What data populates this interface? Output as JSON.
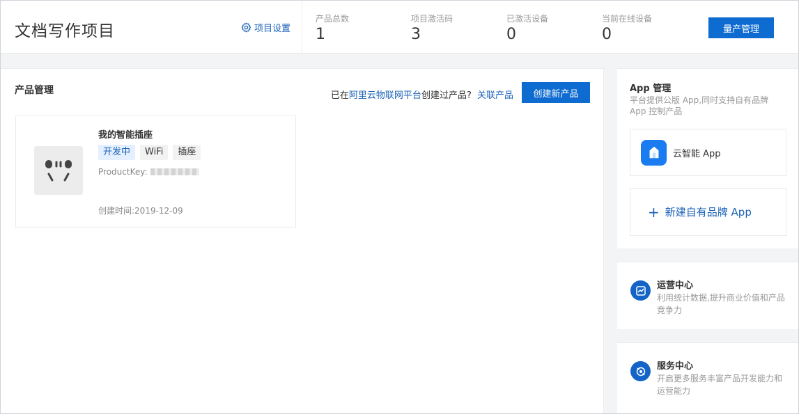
{
  "header": {
    "title": "文档写作项目",
    "settings_label": "项目设置",
    "stats": [
      {
        "label": "产品总数",
        "value": "1"
      },
      {
        "label": "项目激活码",
        "value": "3"
      },
      {
        "label": "已激活设备",
        "value": "0"
      },
      {
        "label": "当前在线设备",
        "value": "0"
      }
    ],
    "mass_production_label": "量产管理"
  },
  "product_management": {
    "title": "产品管理",
    "link_prefix": "已在",
    "platform_link": "阿里云物联网平台",
    "link_middle": "创建过产品?",
    "associate_link": "关联产品",
    "create_button": "创建新产品",
    "products": [
      {
        "name": "我的智能插座",
        "tags": [
          "开发中",
          "WiFi",
          "插座"
        ],
        "product_key_label": "ProductKey:",
        "product_key_masked": true,
        "created_label": "创建时间:",
        "created_date": "2019-12-09",
        "icon": "power-socket-icon"
      }
    ]
  },
  "app_management": {
    "title": "App 管理",
    "description": "平台提供公版 App,同时支持自有品牌 App 控制产品",
    "cloud_app_label": "云智能 App",
    "new_brand_label": "新建自有品牌 App"
  },
  "operations_center": {
    "title": "运营中心",
    "description": "利用统计数据,提升商业价值和产品竞争力"
  },
  "service_center": {
    "title": "服务中心",
    "description": "开启更多服务丰富产品开发能力和运营能力"
  },
  "colors": {
    "accent": "#0e6bd0",
    "link": "#1b62b7",
    "status_tag_bg": "#e4efff"
  }
}
